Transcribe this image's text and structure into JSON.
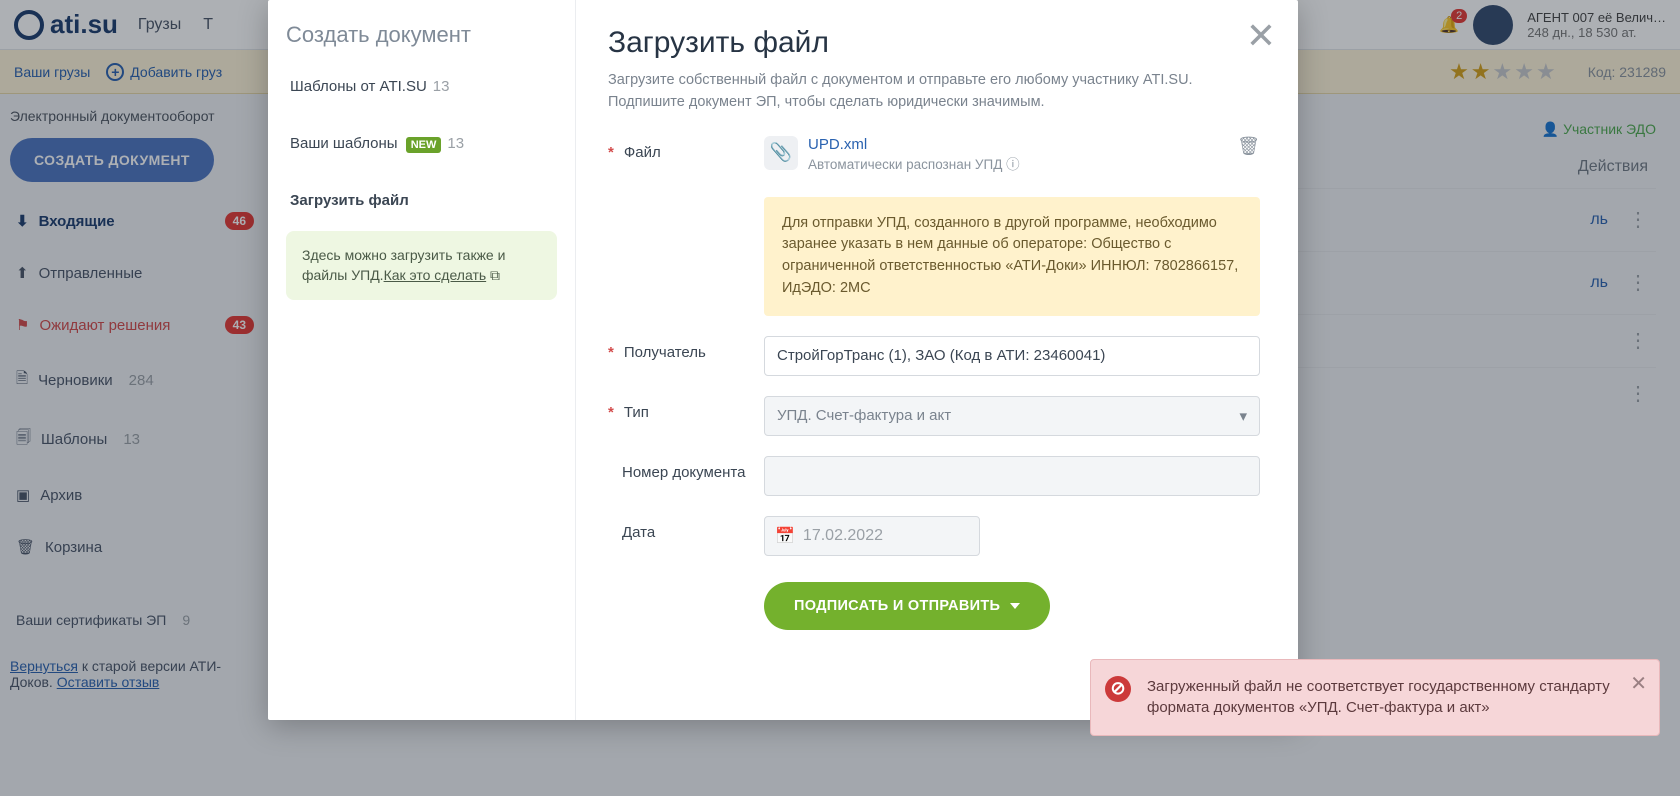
{
  "header": {
    "logo_text": "ati.su",
    "nav": [
      "Грузы",
      "Т"
    ],
    "agent_name": "АГЕНТ 007 её Велич…",
    "agent_sub": "248 дн.,  18 530 ат.",
    "notif_count": "2",
    "code_label": "Код: 231289"
  },
  "toolbar": {
    "your_cargo": "Ваши грузы",
    "add_cargo": "Добавить груз",
    "stars_filled": "★★",
    "stars_empty": "★★★"
  },
  "left": {
    "title": "Электронный документооборот",
    "create": "СОЗДАТЬ ДОКУМЕНТ",
    "items": {
      "inbox": {
        "label": "Входящие",
        "badge": "46"
      },
      "sent": {
        "label": "Отправленные"
      },
      "pending": {
        "label": "Ожидают решения",
        "badge": "43"
      },
      "drafts": {
        "label": "Черновики",
        "count": "284"
      },
      "templates": {
        "label": "Шаблоны",
        "count": "13"
      },
      "archive": {
        "label": "Архив"
      },
      "trash": {
        "label": "Корзина"
      }
    },
    "certs": {
      "label": "Ваши сертификаты ЭП",
      "count": "9"
    },
    "back1": "Вернуться",
    "back2": " к старой версии АТИ-Доков. ",
    "back3": "Оставить отзыв"
  },
  "main": {
    "participant": "Участник ЭДО",
    "col_actions": "Действия",
    "link_text": "ль"
  },
  "modal": {
    "left_title": "Создать документ",
    "nav": {
      "tpl_ati": {
        "label": "Шаблоны от ATI.SU",
        "count": "13"
      },
      "your_tpl": {
        "label": "Ваши шаблоны",
        "new": "NEW",
        "count": "13"
      },
      "upload": {
        "label": "Загрузить файл"
      }
    },
    "hint_text": "Здесь можно загрузить также и файлы УПД.",
    "hint_link": "Как это сделать",
    "title": "Загрузить файл",
    "subtitle": "Загрузите собственный файл с документом и отправьте его любому участнику ATI.SU. Подпишите документ ЭП, чтобы сделать юридически значимым.",
    "labels": {
      "file": "Файл",
      "recipient": "Получатель",
      "type": "Тип",
      "num": "Номер документа",
      "date": "Дата"
    },
    "file": {
      "name": "UPD.xml",
      "desc": "Автоматически распознан УПД"
    },
    "warn": "Для отправки УПД, созданного в другой программе, необходимо заранее указать в нем данные об операторе: Общество с ограниченной ответственностью «АТИ-Доки» ИННЮЛ: 7802866157, ИдЭДО: 2MC",
    "recipient_value": "СтройГорТранс (1), ЗАО (Код в АТИ: 23460041)",
    "type_value": "УПД. Счет-фактура и акт",
    "date_value": "17.02.2022",
    "submit": "ПОДПИСАТЬ И ОТПРАВИТЬ"
  },
  "toast": {
    "text": "Загруженный файл не соответствует государственному стандарту формата документов «УПД. Счет-фактура и акт»"
  }
}
